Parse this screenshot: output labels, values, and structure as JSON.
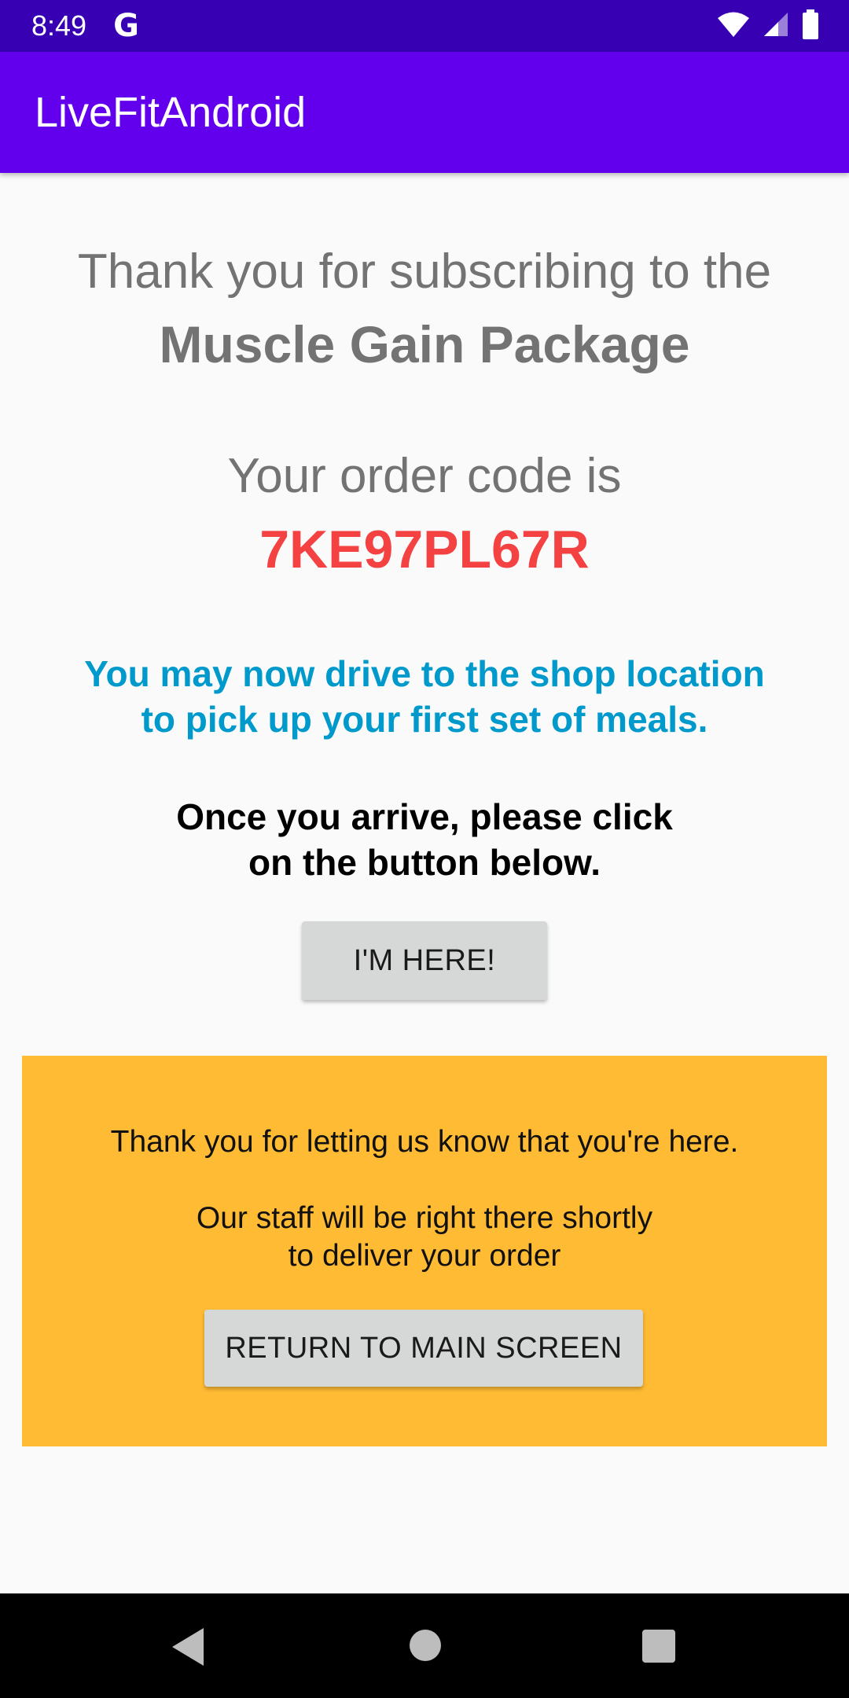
{
  "status_bar": {
    "time": "8:49",
    "google_badge": "G",
    "icons": [
      "wifi-icon",
      "cell-signal-icon",
      "battery-icon"
    ]
  },
  "app_bar": {
    "title": "LiveFitAndroid"
  },
  "main": {
    "thanks_line": "Thank you for subscribing to the",
    "package_name": "Muscle Gain Package",
    "order_label": "Your order code is",
    "order_code": "7KE97PL67R",
    "drive_line1": "You may now drive to the shop location",
    "drive_line2": "to pick up your first set of meals.",
    "arrive_line1": "Once you arrive, please click",
    "arrive_line2": "on the button below.",
    "here_button": "I'M HERE!"
  },
  "confirm_panel": {
    "line1": "Thank you for letting us know that you're here.",
    "line2a": "Our staff will be right there shortly",
    "line2b": "to deliver your order",
    "return_button": "RETURN TO MAIN SCREEN"
  },
  "nav_bar": {
    "buttons": [
      "back-icon",
      "home-icon",
      "recents-icon"
    ]
  },
  "colors": {
    "status_bar": "#3700b3",
    "app_bar": "#6200ee",
    "order_code": "#f44242",
    "drive_message": "#0099cc",
    "confirm_panel": "#ffbb33",
    "button": "#d6d7d7"
  }
}
